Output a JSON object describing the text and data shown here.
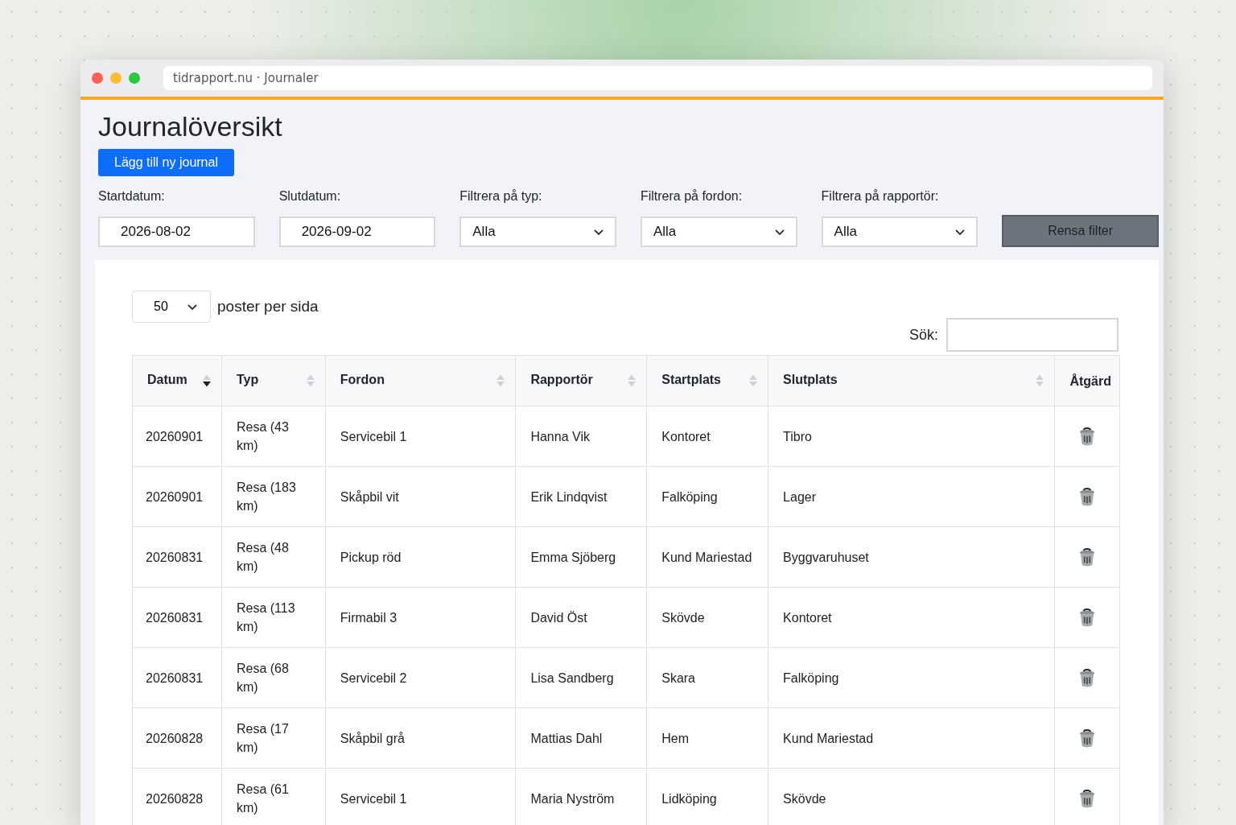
{
  "window": {
    "title": "tidrapport.nu · Journaler"
  },
  "page": {
    "heading": "Journalöversikt",
    "add_button": "Lägg till ny journal"
  },
  "filters": [
    {
      "kind": "date",
      "label": "Startdatum:",
      "value": "2026-08-02"
    },
    {
      "kind": "date",
      "label": "Slutdatum:",
      "value": "2026-09-02"
    },
    {
      "kind": "select",
      "label": "Filtrera på typ:",
      "value": "Alla"
    },
    {
      "kind": "select",
      "label": "Filtrera på fordon:",
      "value": "Alla"
    },
    {
      "kind": "select",
      "label": "Filtrera på rapportör:",
      "value": "Alla"
    }
  ],
  "clear_button": "Rensa filter",
  "table": {
    "page_size": "50",
    "page_size_label": "poster per sida",
    "search_label": "Sök:",
    "columns": [
      {
        "label": "Datum",
        "sortable": true,
        "sorted": true
      },
      {
        "label": "Typ",
        "sortable": true,
        "sorted": false
      },
      {
        "label": "Fordon",
        "sortable": true,
        "sorted": false
      },
      {
        "label": "Rapportör",
        "sortable": true,
        "sorted": false
      },
      {
        "label": "Startplats",
        "sortable": true,
        "sorted": false
      },
      {
        "label": "Slutplats",
        "sortable": true,
        "sorted": false
      },
      {
        "label": "Åtgärd"
      }
    ],
    "rows": [
      [
        "20260901",
        "Resa (43 km)",
        "Servicebil 1",
        "Hanna Vik",
        "Kontoret",
        "Tibro"
      ],
      [
        "20260901",
        "Resa (183 km)",
        "Skåpbil vit",
        "Erik Lindqvist",
        "Falköping",
        "Lager"
      ],
      [
        "20260831",
        "Resa (48 km)",
        "Pickup röd",
        "Emma Sjöberg",
        "Kund Mariestad",
        "Byggvaruhuset"
      ],
      [
        "20260831",
        "Resa (113 km)",
        "Firmabil 3",
        "David Öst",
        "Skövde",
        "Kontoret"
      ],
      [
        "20260831",
        "Resa (68 km)",
        "Servicebil 2",
        "Lisa Sandberg",
        "Skara",
        "Falköping"
      ],
      [
        "20260828",
        "Resa (17 km)",
        "Skåpbil grå",
        "Mattias Dahl",
        "Hem",
        "Kund Mariestad"
      ],
      [
        "20260828",
        "Resa (61 km)",
        "Servicebil 1",
        "Maria Nyström",
        "Lidköping",
        "Skövde"
      ]
    ]
  }
}
